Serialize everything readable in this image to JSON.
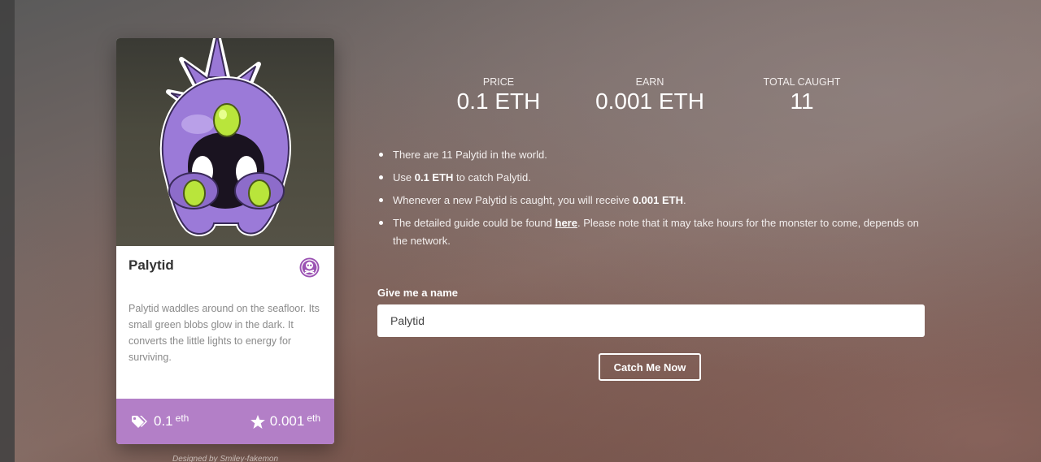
{
  "card": {
    "name": "Palytid",
    "description": "Palytid waddles around on the seafloor. Its small green blobs glow in the dark. It converts the little lights to energy for surviving.",
    "price_value": "0.1",
    "price_unit": "eth",
    "earn_value": "0.001",
    "earn_unit": "eth",
    "type_icon": "poison-type-icon",
    "footer_color": "#b37fc7"
  },
  "designed_by": "Designed by Smiley-fakemon",
  "stats": [
    {
      "label": "PRICE",
      "value": "0.1 ETH"
    },
    {
      "label": "EARN",
      "value": "0.001 ETH"
    },
    {
      "label": "TOTAL CAUGHT",
      "value": "11"
    }
  ],
  "info": {
    "line1": "There are 11 Palytid in the world.",
    "line2_pre": "Use ",
    "line2_bold": "0.1 ETH",
    "line2_post": " to catch Palytid.",
    "line3_pre": "Whenever a new Palytid is caught, you will receive ",
    "line3_bold": "0.001 ETH",
    "line3_post": ".",
    "line4_pre": "The detailed guide could be found ",
    "line4_link": "here",
    "line4_post": ". Please note that it may take hours for the monster to come, depends on the network."
  },
  "form": {
    "label": "Give me a name",
    "value": "Palytid",
    "button": "Catch Me Now"
  }
}
